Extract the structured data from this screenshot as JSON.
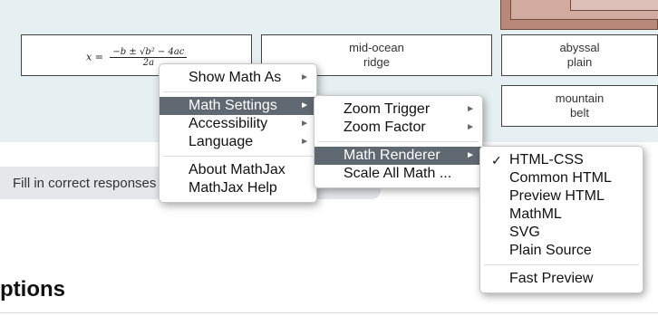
{
  "boxes": {
    "mid_ocean": [
      "mid-ocean",
      "ridge"
    ],
    "abyssal": [
      "abyssal",
      "plain"
    ],
    "mountain": [
      "mountain",
      "belt"
    ]
  },
  "formula": {
    "lhs": "x =",
    "numerator": "−b ± √b² − 4ac",
    "denominator": "2a"
  },
  "fill_prompt": "Fill in correct responses",
  "section_heading": "ptions",
  "menus": {
    "main": {
      "items": [
        "Show Math As",
        "Math Settings",
        "Accessibility",
        "Language"
      ],
      "items2": [
        "About MathJax",
        "MathJax Help"
      ],
      "highlighted": "Math Settings"
    },
    "math_settings": {
      "items": [
        "Zoom Trigger",
        "Zoom Factor"
      ],
      "items2": [
        "Math Renderer",
        "Scale All Math ..."
      ],
      "highlighted": "Math Renderer"
    },
    "math_renderer": {
      "items": [
        "HTML-CSS",
        "Common HTML",
        "Preview HTML",
        "MathML",
        "SVG",
        "Plain Source"
      ],
      "items2": [
        "Fast Preview"
      ],
      "checked": "HTML-CSS",
      "check_mark": "✓"
    },
    "submenu_arrow": "►"
  },
  "colors": {
    "background": "#e6f0f2",
    "highlight": "#606872",
    "image_fill": "#b8887a"
  }
}
